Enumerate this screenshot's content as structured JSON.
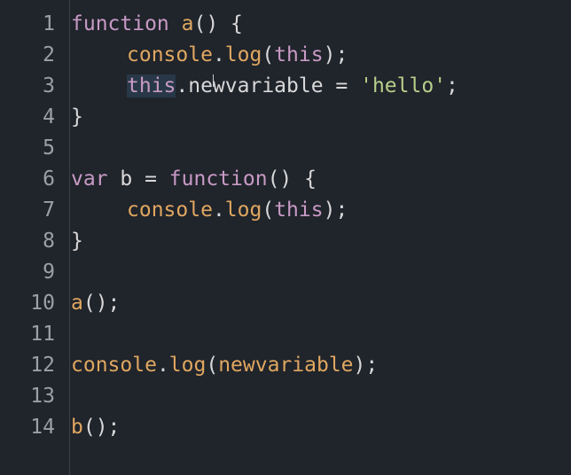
{
  "code_lines": [
    {
      "n": "1",
      "t": [
        "function",
        " ",
        "a",
        "()",
        " {"
      ]
    },
    {
      "n": "2",
      "t": [
        "console",
        ".",
        "log",
        "(",
        "this",
        ");"
      ]
    },
    {
      "n": "3",
      "t": [
        "this",
        ".newvariable",
        " = ",
        "'hello'",
        ";"
      ]
    },
    {
      "n": "4",
      "t": [
        "}"
      ]
    },
    {
      "n": "5",
      "t": []
    },
    {
      "n": "6",
      "t": [
        "var",
        " b = ",
        "function",
        "()",
        " {"
      ]
    },
    {
      "n": "7",
      "t": [
        "console",
        ".",
        "log",
        "(",
        "this",
        ");"
      ]
    },
    {
      "n": "8",
      "t": [
        "}"
      ]
    },
    {
      "n": "9",
      "t": []
    },
    {
      "n": "10",
      "t": [
        "a",
        "();"
      ]
    },
    {
      "n": "11",
      "t": []
    },
    {
      "n": "12",
      "t": [
        "console",
        ".",
        "log",
        "(",
        "newvariable",
        ");"
      ]
    },
    {
      "n": "13",
      "t": []
    },
    {
      "n": "14",
      "t": [
        "b",
        "();"
      ]
    }
  ],
  "colors": {
    "background": "#20242b",
    "keyword": "#c89ac5",
    "function_name": "#e0a760",
    "string": "#b7cf8a",
    "plain": "#d8d8d8",
    "line_number": "#9aa0a8",
    "selection": "#283848"
  }
}
